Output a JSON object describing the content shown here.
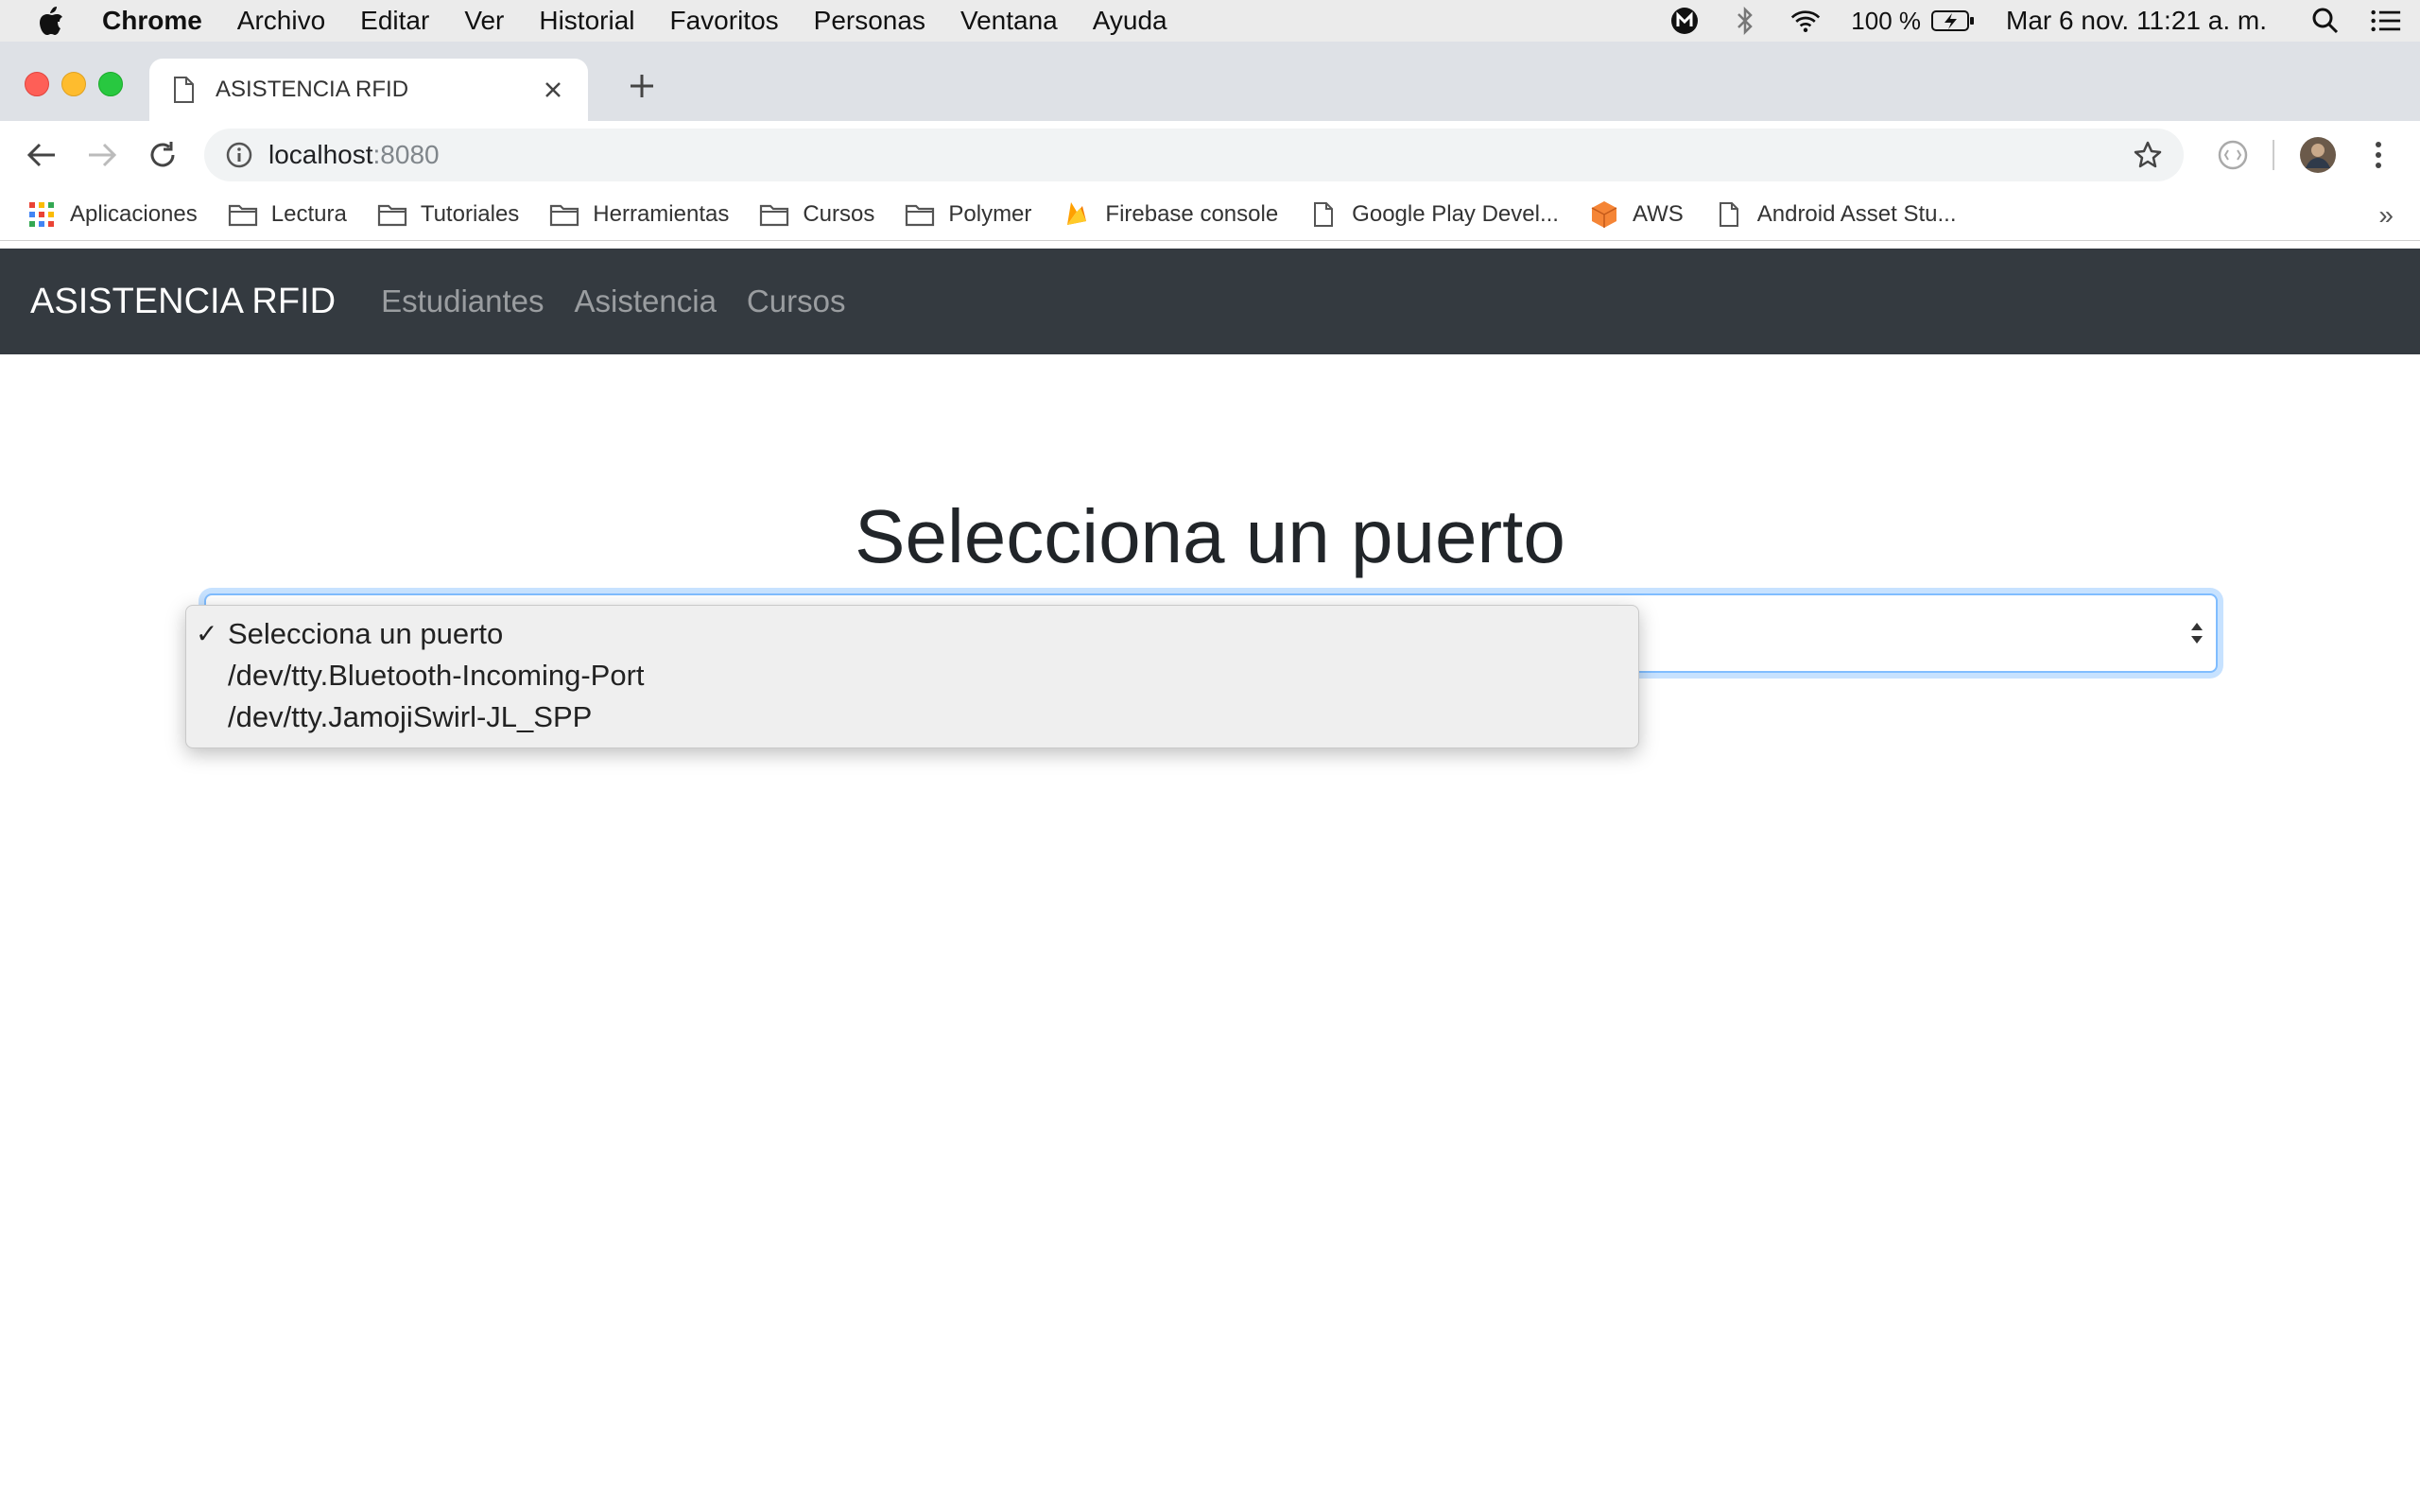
{
  "menubar": {
    "app_name": "Chrome",
    "items": [
      "Archivo",
      "Editar",
      "Ver",
      "Historial",
      "Favoritos",
      "Personas",
      "Ventana",
      "Ayuda"
    ],
    "battery": "100 %",
    "datetime": "Mar 6 nov.  11:21 a. m."
  },
  "tab": {
    "title": "ASISTENCIA RFID"
  },
  "omnibox": {
    "host": "localhost",
    "port": ":8080"
  },
  "bookmarks": {
    "items": [
      {
        "label": "Aplicaciones",
        "icon": "apps-grid-icon"
      },
      {
        "label": "Lectura",
        "icon": "folder-icon"
      },
      {
        "label": "Tutoriales",
        "icon": "folder-icon"
      },
      {
        "label": "Herramientas",
        "icon": "folder-icon"
      },
      {
        "label": "Cursos",
        "icon": "folder-icon"
      },
      {
        "label": "Polymer",
        "icon": "folder-icon"
      },
      {
        "label": "Firebase console",
        "icon": "firebase-icon"
      },
      {
        "label": "Google Play Devel...",
        "icon": "page-icon"
      },
      {
        "label": "AWS",
        "icon": "aws-cube-icon"
      },
      {
        "label": "Android Asset Stu...",
        "icon": "page-icon"
      }
    ],
    "more": "»"
  },
  "appnav": {
    "brand": "ASISTENCIA RFID",
    "links": [
      "Estudiantes",
      "Asistencia",
      "Cursos"
    ]
  },
  "main": {
    "heading": "Selecciona un puerto",
    "select": {
      "selected": "Selecciona un puerto",
      "options": [
        "Selecciona un puerto",
        "/dev/tty.Bluetooth-Incoming-Port",
        "/dev/tty.JamojiSwirl-JL_SPP"
      ]
    }
  },
  "colors": {
    "navbar_bg": "#343a40",
    "focus_ring": "#80bdff",
    "close_red": "#fe5f57",
    "minimize_yellow": "#febc2e",
    "maximize_green": "#28c840"
  }
}
